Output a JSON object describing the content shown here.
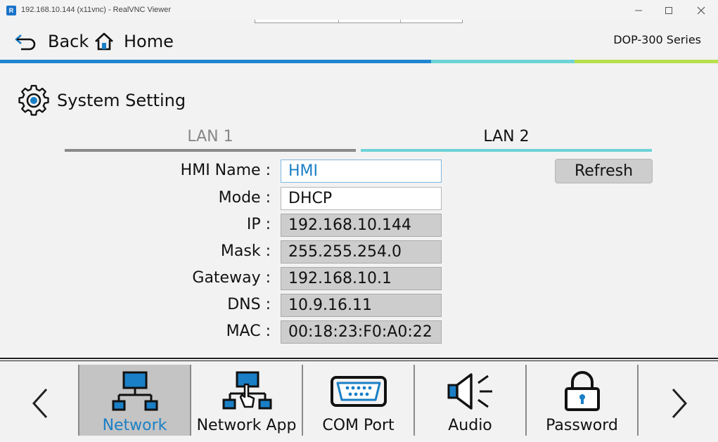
{
  "window": {
    "title": "192.168.10.144 (x11vnc) - RealVNC Viewer",
    "app_icon_text": "R"
  },
  "nav": {
    "back_label": "Back",
    "home_label": "Home",
    "series_label": "DOP-300 Series"
  },
  "colors": {
    "accent_blue": "#1a7fc6",
    "bar_blue": "#1f86cf",
    "bar_cyan": "#6dd3d6",
    "bar_green": "#b7e04d",
    "tab_inactive": "#8a8a8a",
    "tab_active": "#6dd3d6"
  },
  "page": {
    "title": "System Setting",
    "icon": "gear-icon"
  },
  "tabs": [
    {
      "label": "LAN 1",
      "active": false
    },
    {
      "label": "LAN 2",
      "active": true
    }
  ],
  "form": {
    "hmi_name_label": "HMI Name :",
    "hmi_name_value": "HMI",
    "mode_label": "Mode :",
    "mode_value": "DHCP",
    "ip_label": "IP :",
    "ip_value": "192.168.10.144",
    "mask_label": "Mask :",
    "mask_value": "255.255.254.0",
    "gateway_label": "Gateway :",
    "gateway_value": "192.168.10.1",
    "dns_label": "DNS :",
    "dns_value": "10.9.16.11",
    "mac_label": "MAC :",
    "mac_value": "00:18:23:F0:A0:22"
  },
  "refresh_label": "Refresh",
  "bottom": {
    "items": [
      {
        "label": "Network",
        "icon": "network-icon",
        "selected": true
      },
      {
        "label": "Network App",
        "icon": "network-app-icon",
        "selected": false
      },
      {
        "label": "COM Port",
        "icon": "com-port-icon",
        "selected": false
      },
      {
        "label": "Audio",
        "icon": "speaker-icon",
        "selected": false
      },
      {
        "label": "Password",
        "icon": "lock-icon",
        "selected": false
      }
    ]
  }
}
